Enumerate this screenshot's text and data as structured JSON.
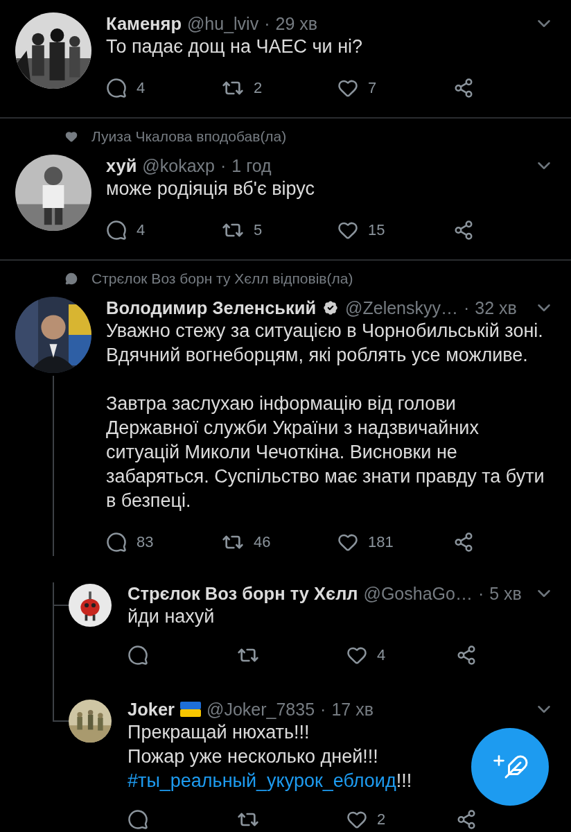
{
  "tweets": [
    {
      "name": "Каменяр",
      "verified": false,
      "flag": false,
      "handle": "@hu_lviv",
      "separator": "·",
      "time": "29 хв",
      "paragraphs": [
        [
          "То падає дощ на ЧАЕС чи ні?"
        ]
      ],
      "actions": {
        "replies": "4",
        "retweets": "2",
        "likes": "7"
      }
    },
    {
      "context": {
        "kind": "like",
        "text": "Луиза Чкалова вподобав(ла)"
      },
      "name": "хуй",
      "verified": false,
      "flag": false,
      "handle": "@kokaxp",
      "separator": "·",
      "time": "1 год",
      "paragraphs": [
        [
          "може родіяція вб'є вірус"
        ]
      ],
      "actions": {
        "replies": "4",
        "retweets": "5",
        "likes": "15"
      }
    },
    {
      "context": {
        "kind": "reply",
        "text": "Стрєлок Воз борн ту Хєлл відповів(ла)"
      },
      "name": "Володимир Зеленський",
      "verified": true,
      "flag": false,
      "handle": "@Zelenskyy…",
      "separator": "·",
      "time": "32 хв",
      "paragraphs": [
        [
          "Уважно стежу за ситуацією в Чорнобильській зоні. Вдячний вогнеборцям, які роблять усе можливе."
        ],
        [
          "Завтра заслухаю інформацію від голови Державної служби України з надзвичайних ситуацій Миколи Чечоткіна. Висновки не забаряться. Суспільство має знати правду та бути в безпеці."
        ]
      ],
      "actions": {
        "replies": "83",
        "retweets": "46",
        "likes": "181"
      },
      "children": [
        {
          "name": "Стрєлок Воз борн ту Хєлл",
          "verified": false,
          "flag": false,
          "handle": "@GoshaGo…",
          "separator": "·",
          "time": "5 хв",
          "paragraphs": [
            [
              "йди нахуй"
            ]
          ],
          "actions": {
            "likes": "4"
          }
        },
        {
          "name": "Joker",
          "verified": false,
          "flag": true,
          "handle": "@Joker_7835",
          "separator": "·",
          "time": "17 хв",
          "paragraphs": [
            [
              "Прекращай нюхать!!!",
              "Пожар уже несколько дней!!!"
            ]
          ],
          "hashtag": "#ты_реальный_укурок_еблоид",
          "hashtag_suffix": "!!!",
          "actions": {
            "likes": "2"
          }
        }
      ]
    }
  ]
}
